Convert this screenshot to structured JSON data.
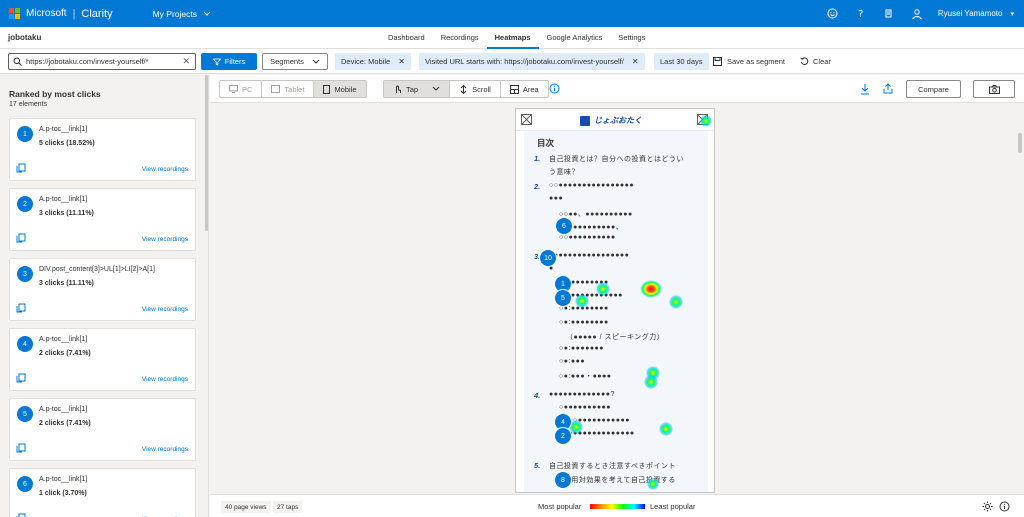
{
  "header": {
    "brand": "Microsoft",
    "product": "Clarity",
    "projects_menu": "My Projects",
    "user_name": "Ryusei Yamamoto",
    "logo_colors": [
      "#f25022",
      "#7fba00",
      "#00a4ef",
      "#ffb900"
    ]
  },
  "nav": {
    "project_name": "jobotaku",
    "tabs": [
      "Dashboard",
      "Recordings",
      "Heatmaps",
      "Google Analytics",
      "Settings"
    ],
    "active_tab": "Heatmaps"
  },
  "filters": {
    "url_value": "https://jobotaku.com/invest-yourself/*",
    "filters_label": "Filters",
    "segments_label": "Segments",
    "chips": [
      "Device: Mobile",
      "Visited URL starts with: https://jobotaku.com/invest-yourself/",
      "Last 30 days"
    ],
    "save_segment": "Save as segment",
    "clear": "Clear"
  },
  "sidebar": {
    "title": "Ranked by most clicks",
    "subtitle": "17 elements",
    "view_label": "View recordings",
    "items": [
      {
        "rank": "1",
        "name": "A.p-toc__link[1]",
        "clicks": "5 clicks (18.52%)"
      },
      {
        "rank": "2",
        "name": "A.p-toc__link[1]",
        "clicks": "3 clicks (11.11%)"
      },
      {
        "rank": "3",
        "name": "DIV.post_content[3]>UL[1]>LI[2]>A[1]",
        "clicks": "3 clicks (11.11%)"
      },
      {
        "rank": "4",
        "name": "A.p-toc__link[1]",
        "clicks": "2 clicks (7.41%)"
      },
      {
        "rank": "5",
        "name": "A.p-toc__link[1]",
        "clicks": "2 clicks (7.41%)"
      },
      {
        "rank": "6",
        "name": "A.p-toc__link[1]",
        "clicks": "1 click (3.70%)"
      }
    ]
  },
  "toolbar": {
    "devices": [
      "PC",
      "Tablet",
      "Mobile"
    ],
    "selected_device": "Mobile",
    "modes": [
      "Tap",
      "Scroll",
      "Area"
    ],
    "selected_mode": "Tap",
    "compare": "Compare"
  },
  "preview": {
    "site_logo": "じょぶおたく",
    "toc_title": "目次",
    "toc_numbers": [
      "1.",
      "2.",
      "3.",
      "4.",
      "5."
    ],
    "toc_lines": [
      "自己投資とは？自分への投資とはどうい",
      "う意味？",
      "○○●●●●●●●●●●●●●●●●",
      "●●●",
      "○○●●、●●●●●●●●●●",
      "○○●●●●●●●●●●、",
      "○○●●●●●●●●●●",
      "●●●●●●●●●●●●●●●●●",
      "●",
      "○●:●●●●●●●●",
      "○●:●●●●●●●●●●●",
      "○●:●●●●●●●●",
      "○●:●●●●●●●●",
      "（●●●●● / スピーキング力）",
      "○●:●●●●●●●",
      "○●:●●●",
      "○●:●●●・●●●●",
      "●●●●●●●●●●●●●?",
      "○●●●●●●●●●●",
      "○○○○●●●●●●●●●●●",
      "○○●●●●●●●●●●●●●●",
      "自己投資するとき注意すべきポイント",
      "○費用対効果を考えて自己投資する"
    ],
    "badges": [
      "6",
      "10",
      "1",
      "5",
      "4",
      "2",
      "8"
    ]
  },
  "footer": {
    "page_views": "40 page views",
    "taps": "27 taps",
    "most_popular": "Most popular",
    "least_popular": "Least popular"
  }
}
